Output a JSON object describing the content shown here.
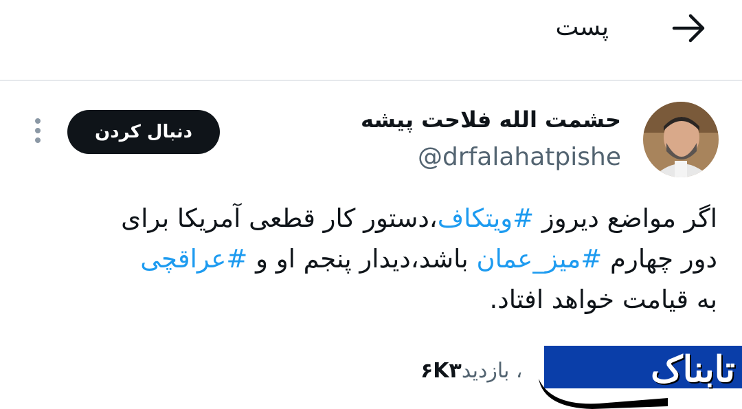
{
  "header": {
    "title": "پست",
    "back_icon": "arrow-right-icon"
  },
  "tweet": {
    "author_name": "حشمت الله فلاحت پیشه",
    "author_handle": "@drfalahatpishe",
    "follow_label": "دنبال کردن",
    "more_icon": "more-vertical-icon",
    "lines": [
      [
        {
          "t": "اگر مواضع دیروز "
        },
        {
          "t": "#ویتکاف",
          "tag": true
        },
        {
          "t": "،دستور کار قطعی آمریکا برای"
        }
      ],
      [
        {
          "t": "دور چهارم "
        },
        {
          "t": "#میز_عمان",
          "tag": true
        },
        {
          "t": " باشد،دیدار پنجم او و "
        },
        {
          "t": "#عراقچی",
          "tag": true
        }
      ],
      [
        {
          "t": "به قیامت خواهد افتاد."
        }
      ]
    ],
    "views_count": "۶K۳",
    "views_label": "، بازدید"
  },
  "watermark": {
    "text": "تابناک",
    "bar_color": "#0a3ea9"
  },
  "colors": {
    "hashtag": "#1d9bf0",
    "text": "#0f1419",
    "secondary": "#536471",
    "follow_bg": "#0f1419"
  }
}
